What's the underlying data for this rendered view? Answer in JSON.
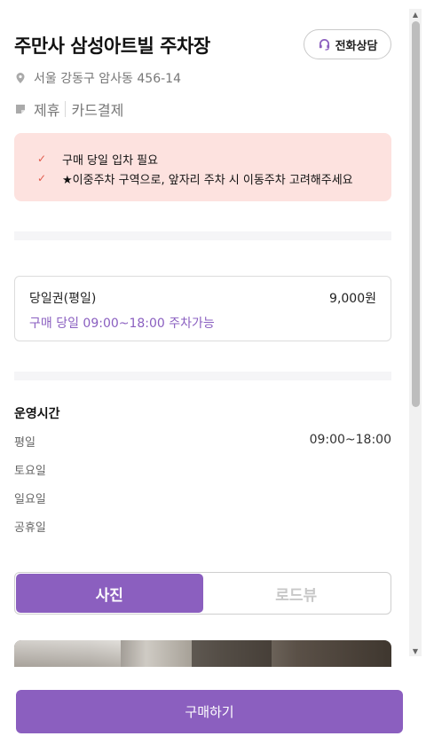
{
  "header": {
    "title": "주만사 삼성아트빌 주차장",
    "call_button": "전화상담",
    "address": "서울 강동구 암사동 456-14",
    "tags": [
      "제휴",
      "카드결제"
    ]
  },
  "notice": {
    "items": [
      "구매 당일 입차 필요",
      "★이중주차 구역으로, 앞자리 주차 시 이동주차 고려해주세요"
    ]
  },
  "ticket": {
    "name": "당일권(평일)",
    "price": "9,000원",
    "availability": "구매 당일 09:00~18:00 주차가능"
  },
  "hours": {
    "title": "운영시간",
    "rows": [
      {
        "day": "평일",
        "time": "09:00~18:00"
      },
      {
        "day": "토요일",
        "time": ""
      },
      {
        "day": "일요일",
        "time": ""
      },
      {
        "day": "공휴일",
        "time": ""
      }
    ]
  },
  "view_tabs": {
    "photo": "사진",
    "roadview": "로드뷰",
    "selected": "사진"
  },
  "footer": {
    "buy_button": "구매하기"
  },
  "colors": {
    "accent": "#8b5fbf",
    "notice_bg": "#fde2df",
    "check": "#e15b4c"
  }
}
